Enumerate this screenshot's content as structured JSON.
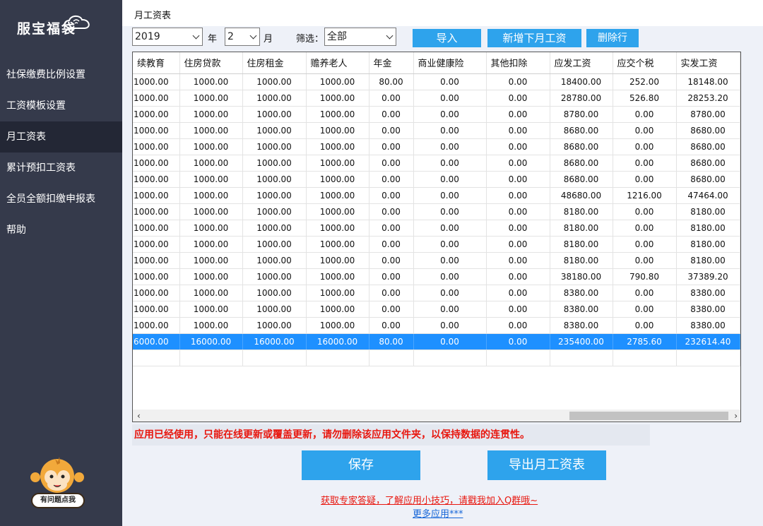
{
  "sidebar": {
    "logo_text": "服宝福袋",
    "items": [
      {
        "label": "社保缴费比例设置"
      },
      {
        "label": "工资模板设置"
      },
      {
        "label": "月工资表"
      },
      {
        "label": "累计预扣工资表"
      },
      {
        "label": "全员全额扣缴申报表"
      },
      {
        "label": "帮助"
      }
    ],
    "active_index": 2,
    "help_button": "有问题点我"
  },
  "header": {
    "title": "月工资表"
  },
  "toolbar": {
    "year_value": "2019",
    "year_label": "年",
    "month_value": "2",
    "month_label": "月",
    "filter_label": "筛选：",
    "filter_value": "全部",
    "import_button": "导入",
    "add_month_button": "新增下月工资",
    "delete_row_button": "删除行"
  },
  "table": {
    "columns": [
      "续教育",
      "住房贷款",
      "住房租金",
      "赡养老人",
      "年金",
      "商业健康险",
      "其他扣除",
      "应发工资",
      "应交个税",
      "实发工资"
    ],
    "rows": [
      [
        "1000.00",
        "1000.00",
        "1000.00",
        "1000.00",
        "80.00",
        "0.00",
        "0.00",
        "18400.00",
        "252.00",
        "18148.00"
      ],
      [
        "1000.00",
        "1000.00",
        "1000.00",
        "1000.00",
        "0.00",
        "0.00",
        "0.00",
        "28780.00",
        "526.80",
        "28253.20"
      ],
      [
        "1000.00",
        "1000.00",
        "1000.00",
        "1000.00",
        "0.00",
        "0.00",
        "0.00",
        "8780.00",
        "0.00",
        "8780.00"
      ],
      [
        "1000.00",
        "1000.00",
        "1000.00",
        "1000.00",
        "0.00",
        "0.00",
        "0.00",
        "8680.00",
        "0.00",
        "8680.00"
      ],
      [
        "1000.00",
        "1000.00",
        "1000.00",
        "1000.00",
        "0.00",
        "0.00",
        "0.00",
        "8680.00",
        "0.00",
        "8680.00"
      ],
      [
        "1000.00",
        "1000.00",
        "1000.00",
        "1000.00",
        "0.00",
        "0.00",
        "0.00",
        "8680.00",
        "0.00",
        "8680.00"
      ],
      [
        "1000.00",
        "1000.00",
        "1000.00",
        "1000.00",
        "0.00",
        "0.00",
        "0.00",
        "8680.00",
        "0.00",
        "8680.00"
      ],
      [
        "1000.00",
        "1000.00",
        "1000.00",
        "1000.00",
        "0.00",
        "0.00",
        "0.00",
        "48680.00",
        "1216.00",
        "47464.00"
      ],
      [
        "1000.00",
        "1000.00",
        "1000.00",
        "1000.00",
        "0.00",
        "0.00",
        "0.00",
        "8180.00",
        "0.00",
        "8180.00"
      ],
      [
        "1000.00",
        "1000.00",
        "1000.00",
        "1000.00",
        "0.00",
        "0.00",
        "0.00",
        "8180.00",
        "0.00",
        "8180.00"
      ],
      [
        "1000.00",
        "1000.00",
        "1000.00",
        "1000.00",
        "0.00",
        "0.00",
        "0.00",
        "8180.00",
        "0.00",
        "8180.00"
      ],
      [
        "1000.00",
        "1000.00",
        "1000.00",
        "1000.00",
        "0.00",
        "0.00",
        "0.00",
        "8180.00",
        "0.00",
        "8180.00"
      ],
      [
        "1000.00",
        "1000.00",
        "1000.00",
        "1000.00",
        "0.00",
        "0.00",
        "0.00",
        "38180.00",
        "790.80",
        "37389.20"
      ],
      [
        "1000.00",
        "1000.00",
        "1000.00",
        "1000.00",
        "0.00",
        "0.00",
        "0.00",
        "8380.00",
        "0.00",
        "8380.00"
      ],
      [
        "1000.00",
        "1000.00",
        "1000.00",
        "1000.00",
        "0.00",
        "0.00",
        "0.00",
        "8380.00",
        "0.00",
        "8380.00"
      ],
      [
        "1000.00",
        "1000.00",
        "1000.00",
        "1000.00",
        "0.00",
        "0.00",
        "0.00",
        "8380.00",
        "0.00",
        "8380.00"
      ],
      [
        "6000.00",
        "16000.00",
        "16000.00",
        "16000.00",
        "80.00",
        "0.00",
        "0.00",
        "235400.00",
        "2785.60",
        "232614.40"
      ],
      [
        "",
        "",
        "",
        "",
        "",
        "",
        "",
        "",
        "",
        ""
      ]
    ],
    "selected_row_index": 16
  },
  "warning": "应用已经使用，只能在线更新或覆盖更新，请勿删除该应用文件夹，以保持数据的连贯性。",
  "actions": {
    "save": "保存",
    "export": "导出月工资表"
  },
  "links": {
    "expert": "获取专家答疑，了解应用小技巧，请戳我加入Q群哦~",
    "more_apps": "更多应用***"
  },
  "colors": {
    "sidebar": "#353a4b",
    "accent": "#2ea3ec",
    "selected_row": "#1e90ff",
    "warning_text": "#e8170f",
    "link_blue": "#1565d8"
  }
}
